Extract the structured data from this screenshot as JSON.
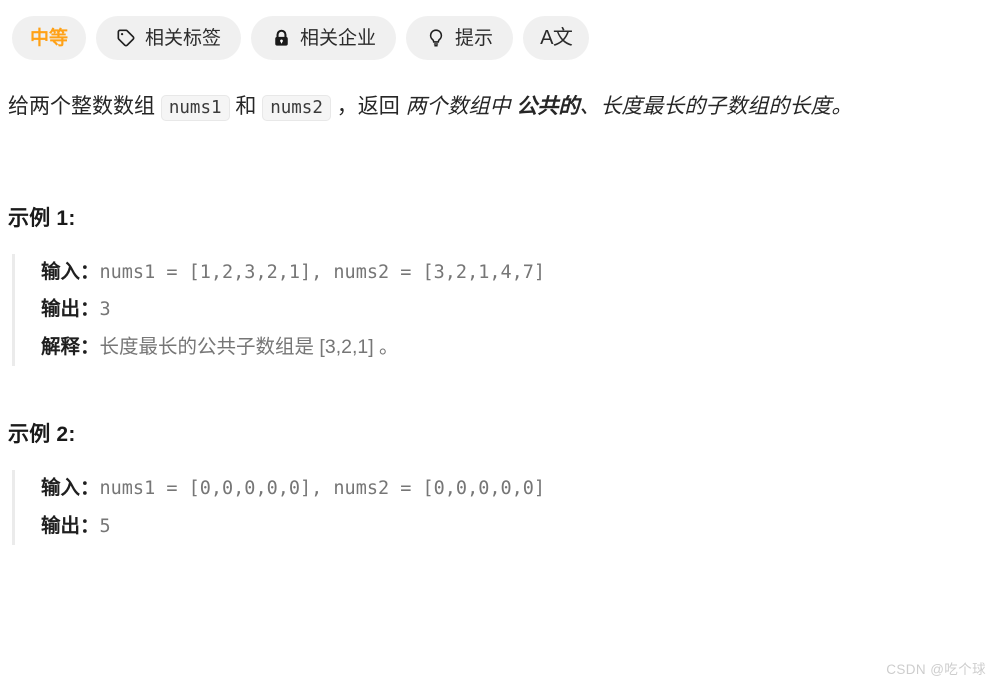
{
  "toolbar": {
    "items": [
      {
        "label": "中等",
        "icon": null,
        "type": "difficulty"
      },
      {
        "label": "相关标签",
        "icon": "tag-icon",
        "type": "normal"
      },
      {
        "label": "相关企业",
        "icon": "lock-icon",
        "type": "normal"
      },
      {
        "label": "提示",
        "icon": "lightbulb-icon",
        "type": "normal"
      },
      {
        "label": "A文",
        "icon": null,
        "type": "square"
      }
    ],
    "difficulty_color": "#ffa116",
    "pill_background": "#f0f0f0"
  },
  "description": {
    "part1": "给两个整数数组 ",
    "code1": "nums1",
    "part2": " 和 ",
    "code2": "nums2",
    "part3": " ，返回 ",
    "italic1": "两个数组中 ",
    "bold_italic": "公共的",
    "italic2": "、长度最长的子数组的长度。"
  },
  "examples": [
    {
      "title": "示例 1:",
      "lines": [
        {
          "key": "输入：",
          "value": "nums1 = [1,2,3,2,1], nums2 = [3,2,1,4,7]",
          "mono": true
        },
        {
          "key": "输出：",
          "value": "3",
          "mono": true
        },
        {
          "key": "解释：",
          "value": "长度最长的公共子数组是 [3,2,1] 。",
          "mono": false
        }
      ]
    },
    {
      "title": "示例 2:",
      "lines": [
        {
          "key": "输入：",
          "value": "nums1 = [0,0,0,0,0], nums2 = [0,0,0,0,0]",
          "mono": true
        },
        {
          "key": "输出：",
          "value": "5",
          "mono": true
        }
      ]
    }
  ],
  "watermark": "CSDN @吃个球"
}
